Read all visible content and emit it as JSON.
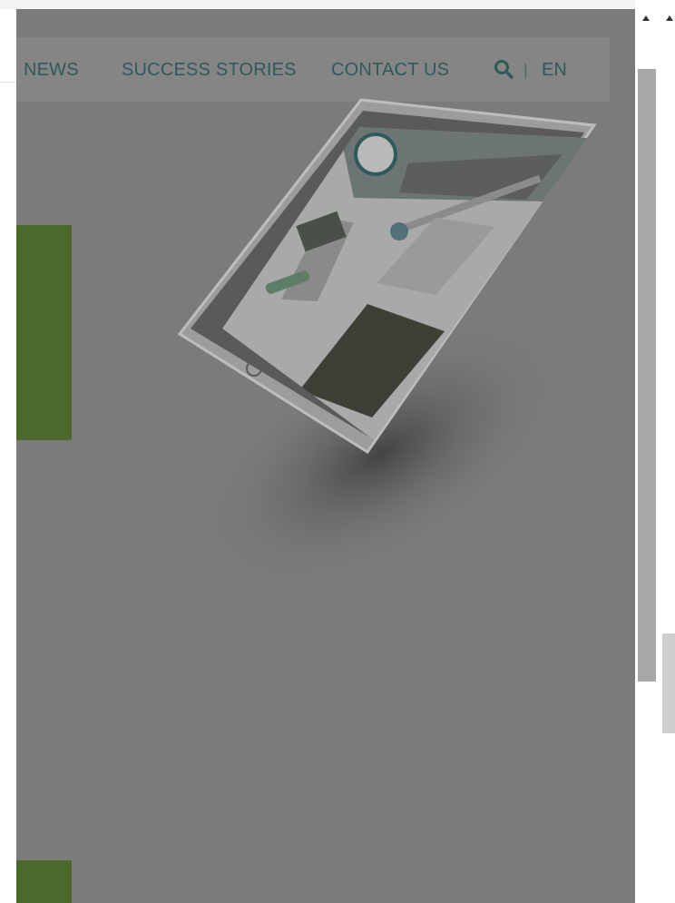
{
  "nav": {
    "items": [
      "NEWS",
      "SUCCESS STORIES",
      "CONTACT US"
    ],
    "separator": "|",
    "language": "EN"
  },
  "icons": {
    "search": "search-icon",
    "scroll_up": "triangle-up-icon"
  },
  "colors": {
    "overlay": "#7b7b7b",
    "nav_text": "#2f5a5a",
    "green_block": "#4d682d",
    "scroll_thumb": "#a8a8a8"
  }
}
